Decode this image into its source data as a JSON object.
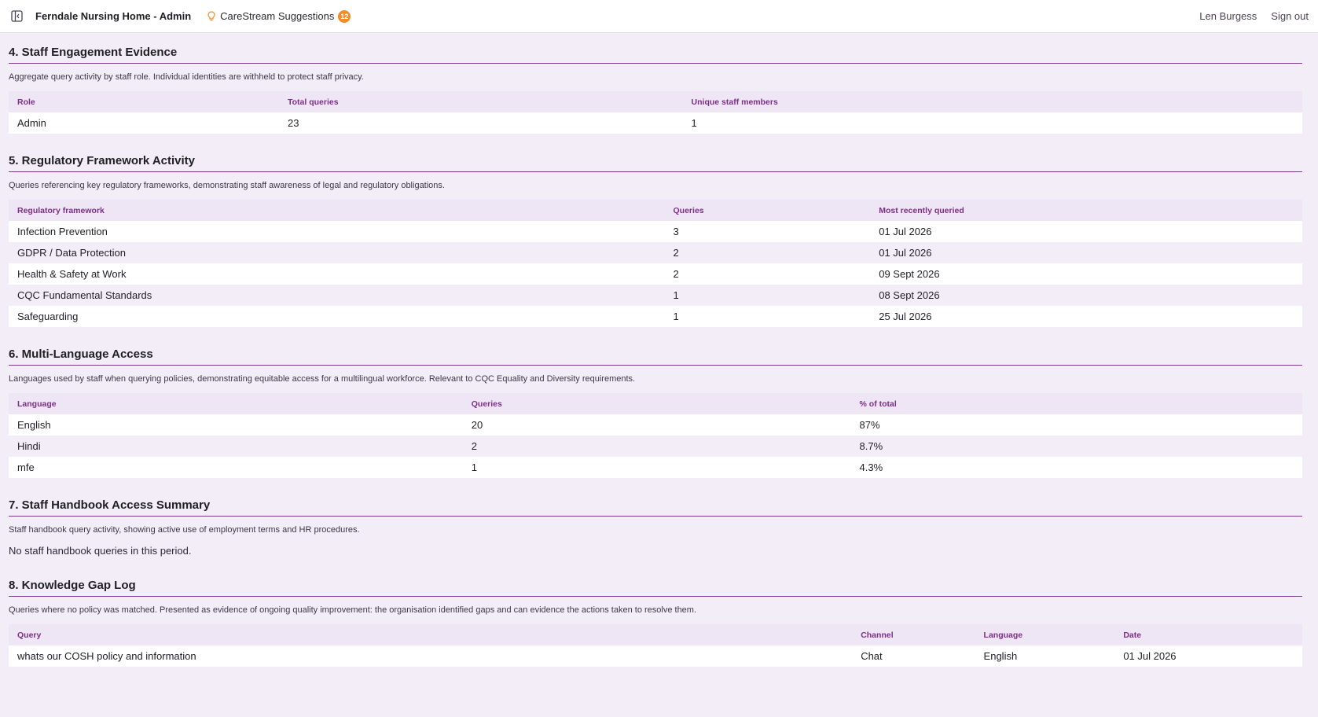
{
  "header": {
    "app_title": "Ferndale Nursing Home - Admin",
    "suggestions_label": "CareStream Suggestions",
    "suggestions_count": "12",
    "user_name": "Len Burgess",
    "sign_out": "Sign out",
    "icons": [
      "sidebar-toggle-icon",
      "lightbulb-icon"
    ],
    "colors": {
      "accent": "#7b2f86",
      "badge": "#f28c28"
    }
  },
  "sections": {
    "staff_engagement": {
      "title": "4. Staff Engagement Evidence",
      "description": "Aggregate query activity by staff role. Individual identities are withheld to protect staff privacy.",
      "columns": [
        "Role",
        "Total queries",
        "Unique staff members"
      ],
      "rows": [
        [
          "Admin",
          "23",
          "1"
        ]
      ]
    },
    "regulatory": {
      "title": "5. Regulatory Framework Activity",
      "description": "Queries referencing key regulatory frameworks, demonstrating staff awareness of legal and regulatory obligations.",
      "columns": [
        "Regulatory framework",
        "Queries",
        "Most recently queried"
      ],
      "rows": [
        [
          "Infection Prevention",
          "3",
          "01 Jul 2026"
        ],
        [
          "GDPR / Data Protection",
          "2",
          "01 Jul 2026"
        ],
        [
          "Health & Safety at Work",
          "2",
          "09 Sept 2026"
        ],
        [
          "CQC Fundamental Standards",
          "1",
          "08 Sept 2026"
        ],
        [
          "Safeguarding",
          "1",
          "25 Jul 2026"
        ]
      ]
    },
    "language": {
      "title": "6. Multi-Language Access",
      "description": "Languages used by staff when querying policies, demonstrating equitable access for a multilingual workforce. Relevant to CQC Equality and Diversity requirements.",
      "columns": [
        "Language",
        "Queries",
        "% of total"
      ],
      "rows": [
        [
          "English",
          "20",
          "87%"
        ],
        [
          "Hindi",
          "2",
          "8.7%"
        ],
        [
          "mfe",
          "1",
          "4.3%"
        ]
      ]
    },
    "handbook": {
      "title": "7. Staff Handbook Access Summary",
      "description": "Staff handbook query activity, showing active use of employment terms and HR procedures.",
      "empty": "No staff handbook queries in this period."
    },
    "knowledge_gap": {
      "title": "8. Knowledge Gap Log",
      "description": "Queries where no policy was matched. Presented as evidence of ongoing quality improvement: the organisation identified gaps and can evidence the actions taken to resolve them.",
      "columns": [
        "Query",
        "Channel",
        "Language",
        "Date"
      ],
      "rows": [
        [
          "whats our COSH policy and information",
          "Chat",
          "English",
          "01 Jul 2026"
        ]
      ]
    }
  }
}
